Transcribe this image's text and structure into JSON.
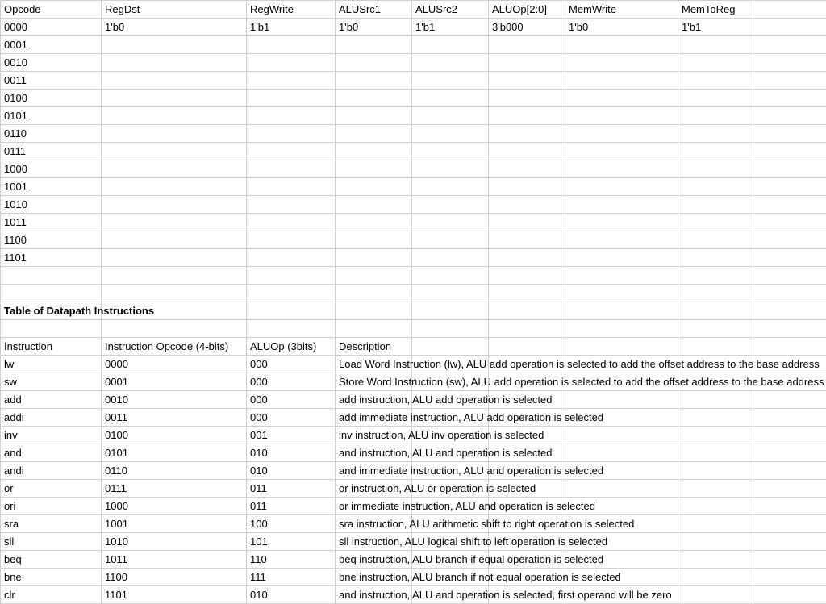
{
  "table1": {
    "headers": [
      "Opcode",
      "RegDst",
      "RegWrite",
      "ALUSrc1",
      "ALUSrc2",
      "ALUOp[2:0]",
      "MemWrite",
      "MemToReg"
    ],
    "rows": [
      [
        "0000",
        "1'b0",
        "1'b1",
        "1'b0",
        "1'b1",
        "3'b000",
        "1'b0",
        "1'b1"
      ],
      [
        "0001",
        "",
        "",
        "",
        "",
        "",
        "",
        ""
      ],
      [
        "0010",
        "",
        "",
        "",
        "",
        "",
        "",
        ""
      ],
      [
        "0011",
        "",
        "",
        "",
        "",
        "",
        "",
        ""
      ],
      [
        "0100",
        "",
        "",
        "",
        "",
        "",
        "",
        ""
      ],
      [
        "0101",
        "",
        "",
        "",
        "",
        "",
        "",
        ""
      ],
      [
        "0110",
        "",
        "",
        "",
        "",
        "",
        "",
        ""
      ],
      [
        "0111",
        "",
        "",
        "",
        "",
        "",
        "",
        ""
      ],
      [
        "1000",
        "",
        "",
        "",
        "",
        "",
        "",
        ""
      ],
      [
        "1001",
        "",
        "",
        "",
        "",
        "",
        "",
        ""
      ],
      [
        "1010",
        "",
        "",
        "",
        "",
        "",
        "",
        ""
      ],
      [
        "1011",
        "",
        "",
        "",
        "",
        "",
        "",
        ""
      ],
      [
        "1100",
        "",
        "",
        "",
        "",
        "",
        "",
        ""
      ],
      [
        "1101",
        "",
        "",
        "",
        "",
        "",
        "",
        ""
      ]
    ]
  },
  "section_title": "Table of Datapath Instructions",
  "table2": {
    "headers": [
      "Instruction",
      "Instruction Opcode (4-bits)",
      "ALUOp (3bits)",
      "Description"
    ],
    "rows": [
      [
        "lw",
        "0000",
        "000",
        "Load Word Instruction (lw), ALU add operation is selected to add the offset address to the base address"
      ],
      [
        "sw",
        "0001",
        "000",
        "Store Word Instruction (sw), ALU add operation is selected to add the offset address to the base address"
      ],
      [
        "add",
        "0010",
        "000",
        "add instruction, ALU add operation is selected"
      ],
      [
        "addi",
        "0011",
        "000",
        "add immediate instruction, ALU add operation is selected"
      ],
      [
        "inv",
        "0100",
        "001",
        "inv instruction, ALU inv operation is selected"
      ],
      [
        "and",
        "0101",
        "010",
        "and instruction, ALU and operation is selected"
      ],
      [
        "andi",
        "0110",
        "010",
        "and immediate instruction, ALU and operation is selected"
      ],
      [
        "or",
        "0111",
        "011",
        "or instruction, ALU or operation is selected"
      ],
      [
        "ori",
        "1000",
        "011",
        "or immediate instruction, ALU and operation is selected"
      ],
      [
        "sra",
        "1001",
        "100",
        "sra instruction, ALU arithmetic shift to right operation is selected"
      ],
      [
        "sll",
        "1010",
        "101",
        "sll instruction, ALU logical shift to left operation is selected"
      ],
      [
        "beq",
        "1011",
        "110",
        "beq instruction, ALU branch if equal operation is selected"
      ],
      [
        "bne",
        "1100",
        "111",
        "bne instruction, ALU branch if not equal operation is selected"
      ],
      [
        "clr",
        "1101",
        "010",
        "and instruction, ALU and operation is selected, first operand will be zero"
      ]
    ]
  }
}
